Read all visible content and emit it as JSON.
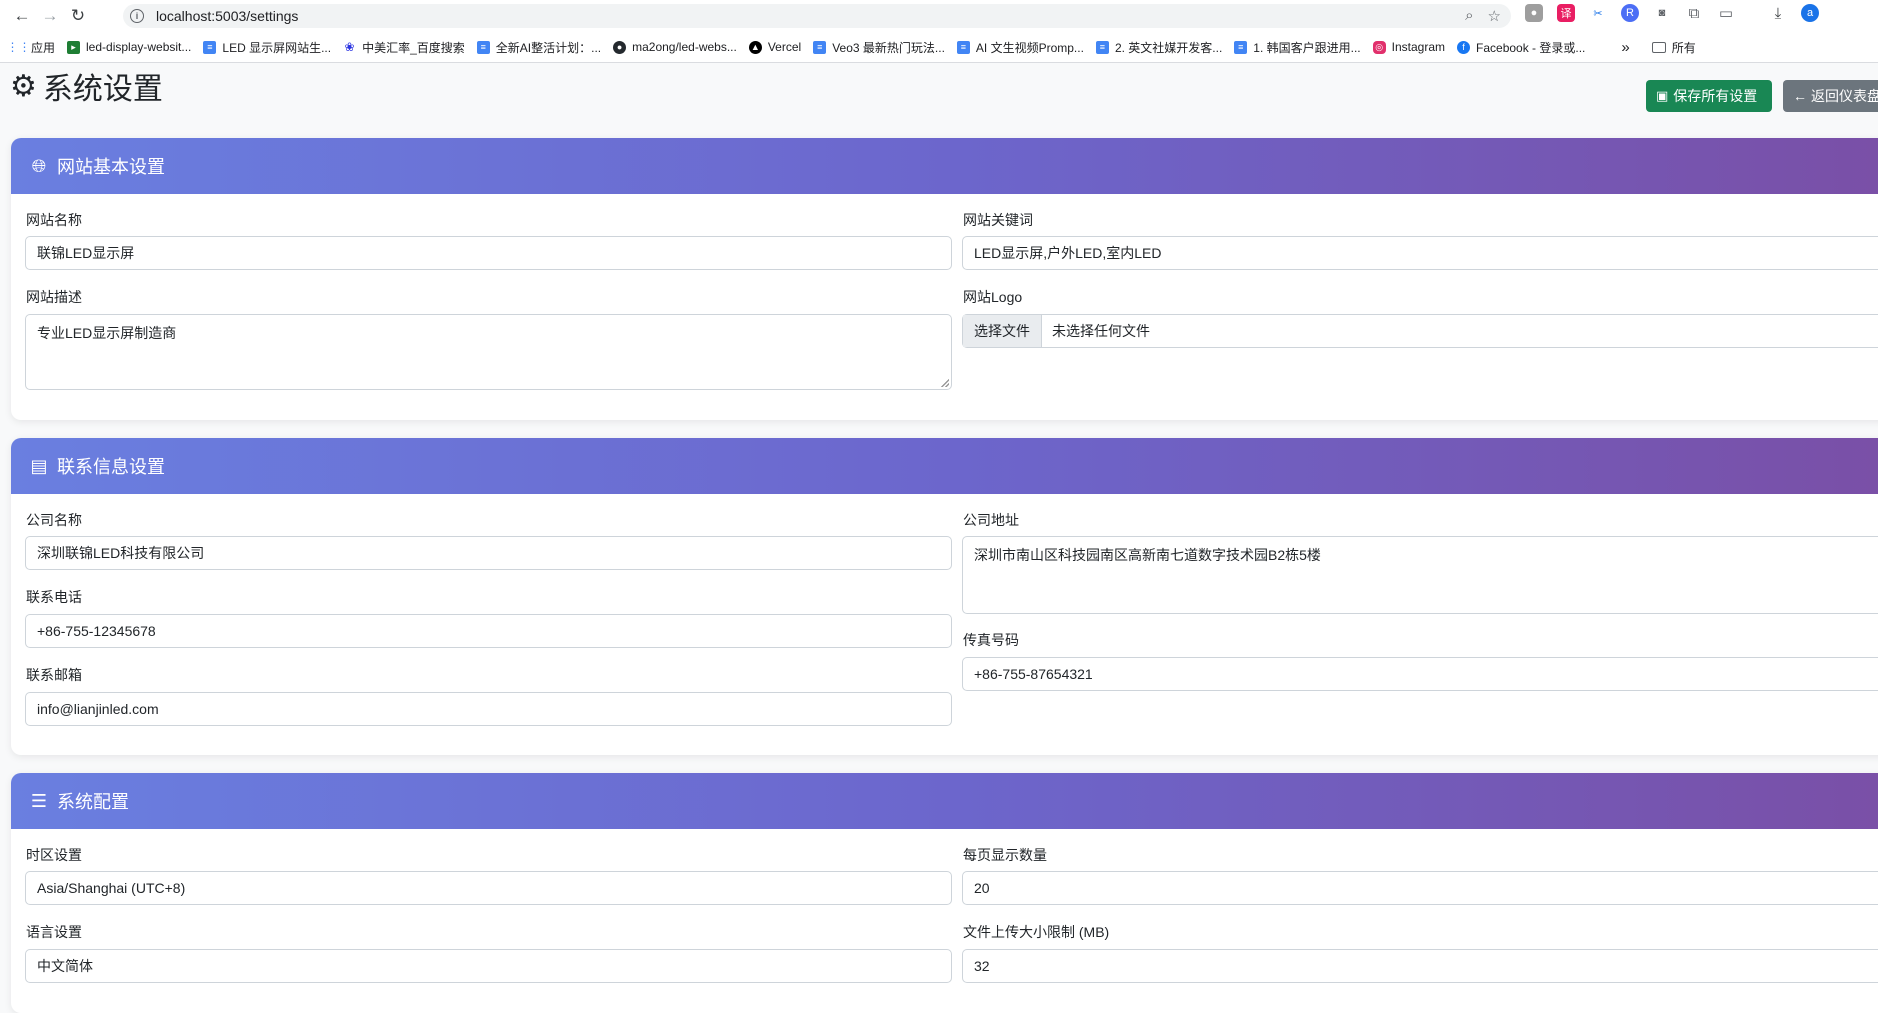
{
  "browser": {
    "url": "localhost:5003/settings",
    "bookmarks": [
      {
        "label": "应用",
        "icon": "apps-grid-icon",
        "color": "#4285f4"
      },
      {
        "label": "led-display-websit...",
        "icon": "terminal-icon",
        "color": "#1e7e34"
      },
      {
        "label": "LED 显示屏网站生...",
        "icon": "doc-icon",
        "color": "#4285f4"
      },
      {
        "label": "中美汇率_百度搜索",
        "icon": "baidu-icon",
        "color": "#2932e1"
      },
      {
        "label": "全新AI整活计划：...",
        "icon": "doc-icon",
        "color": "#4285f4"
      },
      {
        "label": "ma2ong/led-webs...",
        "icon": "github-icon",
        "color": "#24292e"
      },
      {
        "label": "Vercel",
        "icon": "vercel-icon",
        "color": "#000000"
      },
      {
        "label": "Veo3 最新热门玩法...",
        "icon": "doc-icon",
        "color": "#4285f4"
      },
      {
        "label": "AI 文生视频Promp...",
        "icon": "doc-icon",
        "color": "#4285f4"
      },
      {
        "label": "2. 英文社媒开发客...",
        "icon": "doc-icon",
        "color": "#4285f4"
      },
      {
        "label": "1. 韩国客户跟进用...",
        "icon": "doc-icon",
        "color": "#4285f4"
      },
      {
        "label": "Instagram",
        "icon": "instagram-icon",
        "color": "#e1306c"
      },
      {
        "label": "Facebook - 登录或...",
        "icon": "facebook-icon",
        "color": "#1877f2"
      }
    ],
    "more_label": "»",
    "all_bookmarks_label": "所有"
  },
  "page": {
    "title": "系统设置",
    "save_button": "保存所有设置",
    "back_button": "返回仪表盘"
  },
  "sections": {
    "basic": {
      "title": "网站基本设置",
      "site_name_label": "网站名称",
      "site_name_value": "联锦LED显示屏",
      "keywords_label": "网站关键词",
      "keywords_value": "LED显示屏,户外LED,室内LED",
      "description_label": "网站描述",
      "description_value": "专业LED显示屏制造商",
      "logo_label": "网站Logo",
      "logo_button": "选择文件",
      "logo_status": "未选择任何文件"
    },
    "contact": {
      "title": "联系信息设置",
      "company_label": "公司名称",
      "company_value": "深圳联锦LED科技有限公司",
      "address_label": "公司地址",
      "address_value": "深圳市南山区科技园南区高新南七道数字技术园B2栋5楼",
      "phone_label": "联系电话",
      "phone_value": "+86-755-12345678",
      "fax_label": "传真号码",
      "fax_value": "+86-755-87654321",
      "email_label": "联系邮箱",
      "email_value": "info@lianjinled.com"
    },
    "system": {
      "title": "系统配置",
      "timezone_label": "时区设置",
      "timezone_value": "Asia/Shanghai (UTC+8)",
      "per_page_label": "每页显示数量",
      "per_page_value": "20",
      "language_label": "语言设置",
      "language_value": "中文简体",
      "upload_label": "文件上传大小限制 (MB)",
      "upload_value": "32"
    }
  }
}
